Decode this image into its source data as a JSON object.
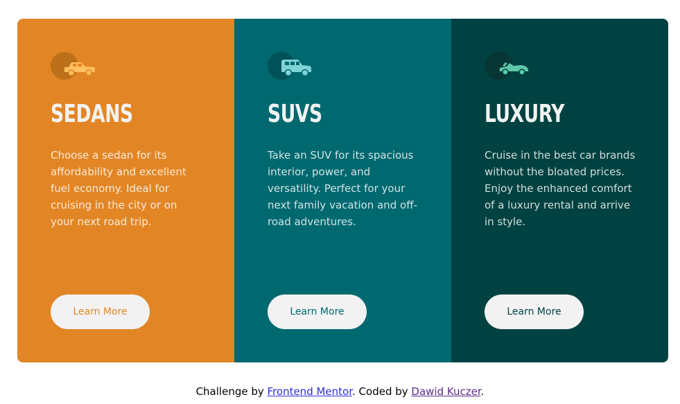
{
  "colors": {
    "sedans_bg": "#e28625",
    "suvs_bg": "#006970",
    "luxury_bg": "#004241",
    "button_bg": "#f2f2f2",
    "title_color": "#f2f2f2"
  },
  "cards": [
    {
      "icon": "sedan-car-icon",
      "title": "Sedans",
      "description": "Choose a sedan for its affordability and excellent fuel economy. Ideal for cruising in the city or on your next road trip.",
      "button_label": "Learn More"
    },
    {
      "icon": "suv-car-icon",
      "title": "SUVs",
      "description": "Take an SUV for its spacious interior, power, and versatility. Perfect for your next family vacation and off-road adventures.",
      "button_label": "Learn More"
    },
    {
      "icon": "luxury-car-icon",
      "title": "Luxury",
      "description": "Cruise in the best car brands without the bloated prices. Enjoy the enhanced comfort of a luxury rental and arrive in style.",
      "button_label": "Learn More"
    }
  ],
  "attribution": {
    "prefix": "Challenge by ",
    "challenge_link": "Frontend Mentor",
    "middle": ". Coded by ",
    "author_link": "Dawid Kuczer",
    "suffix": "."
  }
}
